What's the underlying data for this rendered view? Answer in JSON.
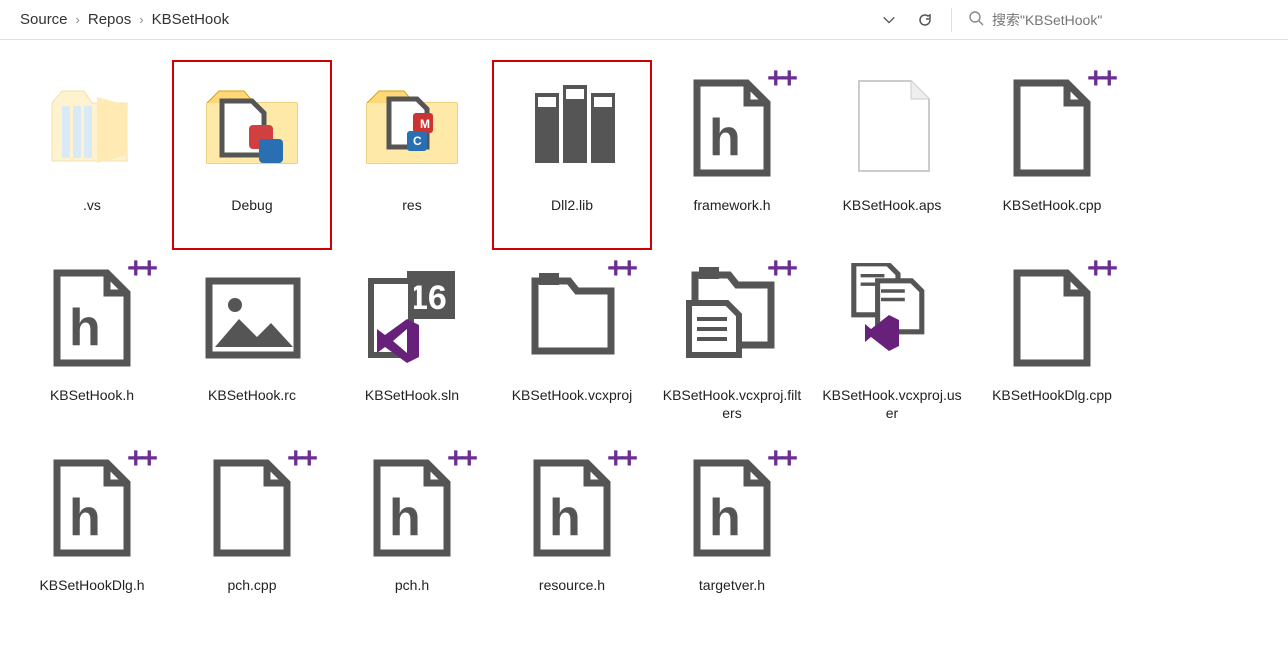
{
  "toolbar": {
    "breadcrumb": [
      "Source",
      "Repos",
      "KBSetHook"
    ],
    "search_placeholder": "搜索\"KBSetHook\""
  },
  "files": [
    {
      "name": ".vs",
      "icon": "folder-hidden",
      "selected": false
    },
    {
      "name": "Debug",
      "icon": "folder-project",
      "selected": true
    },
    {
      "name": "res",
      "icon": "folder-resource",
      "selected": false
    },
    {
      "name": "Dll2.lib",
      "icon": "lib",
      "selected": true
    },
    {
      "name": "framework.h",
      "icon": "h-cpp",
      "selected": false
    },
    {
      "name": "KBSetHook.aps",
      "icon": "blank-file",
      "selected": false
    },
    {
      "name": "KBSetHook.cpp",
      "icon": "cpp",
      "selected": false
    },
    {
      "name": "KBSetHook.h",
      "icon": "h-cpp",
      "selected": false
    },
    {
      "name": "KBSetHook.rc",
      "icon": "image",
      "selected": false
    },
    {
      "name": "KBSetHook.sln",
      "icon": "sln",
      "selected": false
    },
    {
      "name": "KBSetHook.vcxproj",
      "icon": "vcxproj",
      "selected": false
    },
    {
      "name": "KBSetHook.vcxproj.filters",
      "icon": "vcxproj-filters",
      "selected": false
    },
    {
      "name": "KBSetHook.vcxproj.user",
      "icon": "vcxproj-user",
      "selected": false
    },
    {
      "name": "KBSetHookDlg.cpp",
      "icon": "cpp",
      "selected": false
    },
    {
      "name": "KBSetHookDlg.h",
      "icon": "h-cpp",
      "selected": false
    },
    {
      "name": "pch.cpp",
      "icon": "cpp",
      "selected": false
    },
    {
      "name": "pch.h",
      "icon": "h-cpp",
      "selected": false
    },
    {
      "name": "resource.h",
      "icon": "h-cpp",
      "selected": false
    },
    {
      "name": "targetver.h",
      "icon": "h-cpp",
      "selected": false
    }
  ]
}
